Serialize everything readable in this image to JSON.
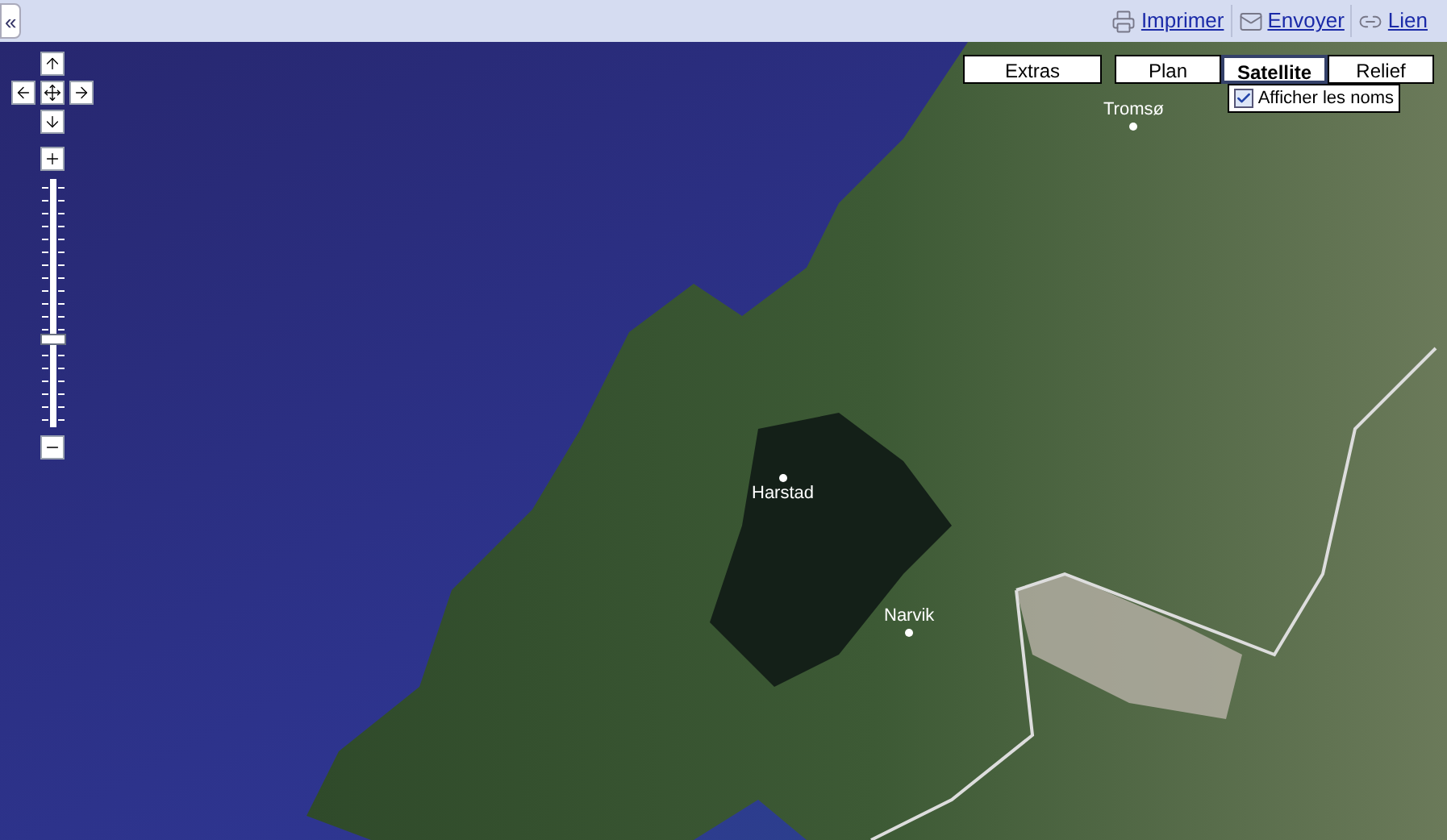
{
  "toolbar": {
    "collapse_button": "«",
    "links": [
      {
        "label": "Imprimer"
      },
      {
        "label": "Envoyer"
      },
      {
        "label": "Lien"
      }
    ]
  },
  "map": {
    "zoom": {
      "level": 0.34
    },
    "map_types": [
      {
        "label": "Extras",
        "selected": false
      },
      {
        "label": "Plan",
        "selected": false
      },
      {
        "label": "Satellite",
        "selected": true
      },
      {
        "label": "Relief",
        "selected": false
      }
    ],
    "show_labels": {
      "label": "Afficher les noms",
      "checked": true
    },
    "places": [
      {
        "name": "Tromsø"
      },
      {
        "name": "Harstad"
      },
      {
        "name": "Narvik"
      }
    ]
  }
}
